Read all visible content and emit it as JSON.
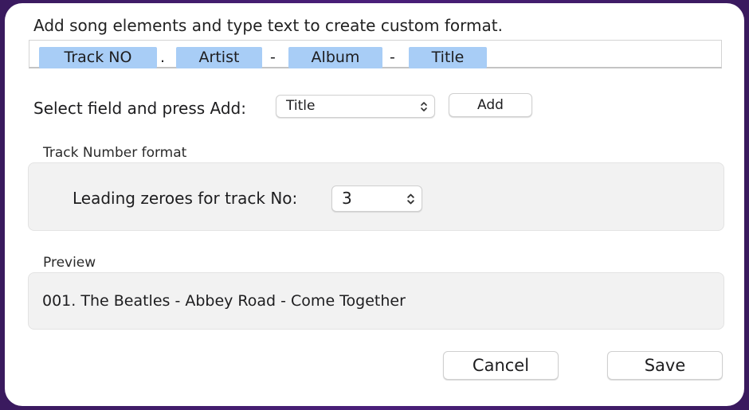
{
  "dialog": {
    "instruction": "Add song elements and type text to create custom format.",
    "tokens": [
      {
        "type": "token",
        "label": "Track NO"
      },
      {
        "type": "sep",
        "label": "."
      },
      {
        "type": "token",
        "label": "Artist"
      },
      {
        "type": "sep",
        "label": "-"
      },
      {
        "type": "token",
        "label": "Album"
      },
      {
        "type": "sep",
        "label": "-"
      },
      {
        "type": "token",
        "label": "Title"
      }
    ],
    "select_field": {
      "label": "Select field and press Add:",
      "selected": "Title",
      "add_label": "Add",
      "chevron_icon": "chevron-up-down-icon"
    },
    "track_number": {
      "group_label": "Track Number format",
      "leading_zeroes_label": "Leading zeroes for track No:",
      "leading_zeroes_value": "3",
      "chevron_icon": "chevron-up-down-icon"
    },
    "preview": {
      "group_label": "Preview",
      "text": "001. The Beatles - Abbey Road - Come Together"
    },
    "buttons": {
      "cancel": "Cancel",
      "save": "Save"
    }
  },
  "colors": {
    "token_bg": "#a8cdf6",
    "box_bg": "#f2f2f2",
    "backdrop": "#4a1f7a"
  }
}
